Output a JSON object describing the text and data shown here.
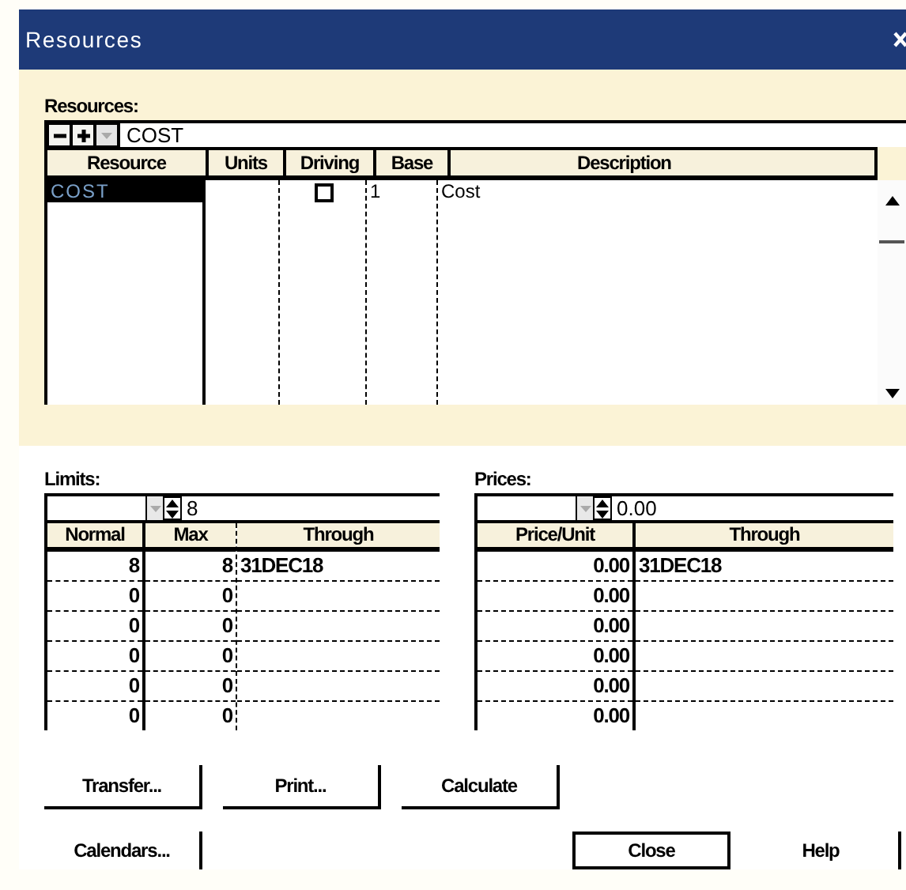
{
  "window": {
    "title": "Resources"
  },
  "resources": {
    "label": "Resources:",
    "edit_value": "COST",
    "columns": [
      "Resource",
      "Units",
      "Driving",
      "Base",
      "Description"
    ],
    "rows": [
      {
        "resource": "COST",
        "driving": false,
        "base": "1",
        "description": "Cost",
        "selected": true
      }
    ]
  },
  "limits": {
    "label": "Limits:",
    "edit_value": "8",
    "columns": [
      "Normal",
      "Max",
      "Through"
    ],
    "rows": [
      [
        "8",
        "8",
        "31DEC18"
      ],
      [
        "0",
        "0"
      ],
      [
        "0",
        "0"
      ],
      [
        "0",
        "0"
      ],
      [
        "0",
        "0"
      ],
      [
        "0",
        "0"
      ]
    ]
  },
  "prices": {
    "label": "Prices:",
    "edit_value": "0.00",
    "columns": [
      "Price/Unit",
      "Through"
    ],
    "rows": [
      [
        "0.00",
        "31DEC18"
      ],
      [
        "0.00"
      ],
      [
        "0.00"
      ],
      [
        "0.00"
      ],
      [
        "0.00"
      ],
      [
        "0.00"
      ]
    ]
  },
  "buttons": [
    {
      "label": "Transfer...",
      "kind": "normal"
    },
    {
      "label": "Print...",
      "kind": "normal"
    },
    {
      "label": "Calculate",
      "kind": "normal"
    },
    {
      "label": "Calendars...",
      "kind": "normal"
    },
    {
      "label": "Close",
      "kind": "default"
    },
    {
      "label": "Help",
      "kind": "normal"
    }
  ]
}
